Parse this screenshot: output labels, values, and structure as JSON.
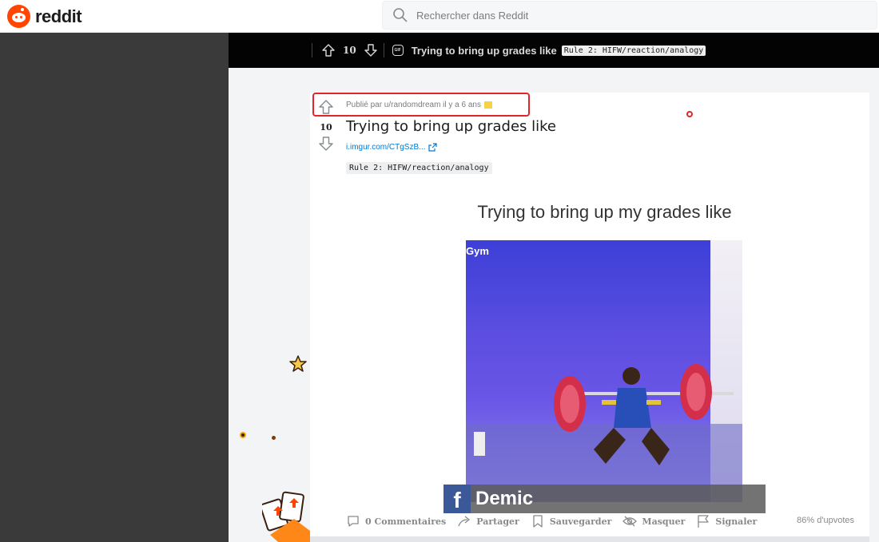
{
  "app": {
    "logo_text": "reddit"
  },
  "search": {
    "placeholder": "Rechercher dans Reddit"
  },
  "post_header": {
    "score": "10",
    "title": "Trying to bring up grades like",
    "flair": "Rule 2: HIFW/reaction/analogy"
  },
  "post": {
    "meta": "Publié par u/randomdream il y a 6 ans",
    "score": "10",
    "title": "Trying to bring up grades like",
    "link": "i.imgur.com/CTgSzB...",
    "flair": "Rule 2: HIFW/reaction/analogy"
  },
  "media": {
    "caption": "Trying to bring up my grades like",
    "watermark": "Gym",
    "fb_letter": "f",
    "fb_name": "Demic"
  },
  "actions": {
    "comments": "0 Commentaires",
    "share": "Partager",
    "save": "Sauvegarder",
    "hide": "Masquer",
    "report": "Signaler",
    "upvote_ratio": "86% d'upvotes"
  },
  "colors": {
    "brand": "#ff4500",
    "highlight": "#e0262d",
    "link": "#0079d3"
  }
}
